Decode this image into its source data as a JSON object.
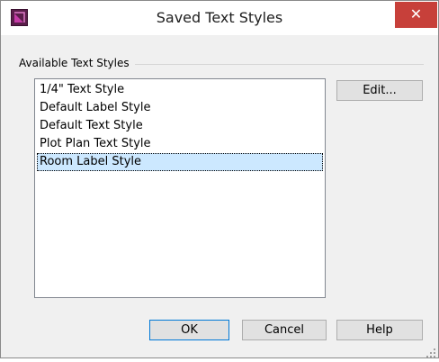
{
  "window": {
    "title": "Saved Text Styles",
    "close_symbol": "✕"
  },
  "group": {
    "label": "Available Text Styles"
  },
  "list": {
    "items": [
      {
        "label": "1/4\" Text Style"
      },
      {
        "label": "Default Label Style"
      },
      {
        "label": "Default Text Style"
      },
      {
        "label": "Plot Plan Text Style"
      },
      {
        "label": "Room Label Style"
      }
    ],
    "selected": "Room Label Style"
  },
  "buttons": {
    "edit": "Edit...",
    "ok": "OK",
    "cancel": "Cancel",
    "help": "Help"
  },
  "colors": {
    "close_button": "#c7403a",
    "selection": "#cce8ff",
    "app_icon": "#5a1e4a"
  },
  "icons": {
    "app": "app-icon",
    "close": "close-icon",
    "grip": "resize-grip-icon"
  }
}
